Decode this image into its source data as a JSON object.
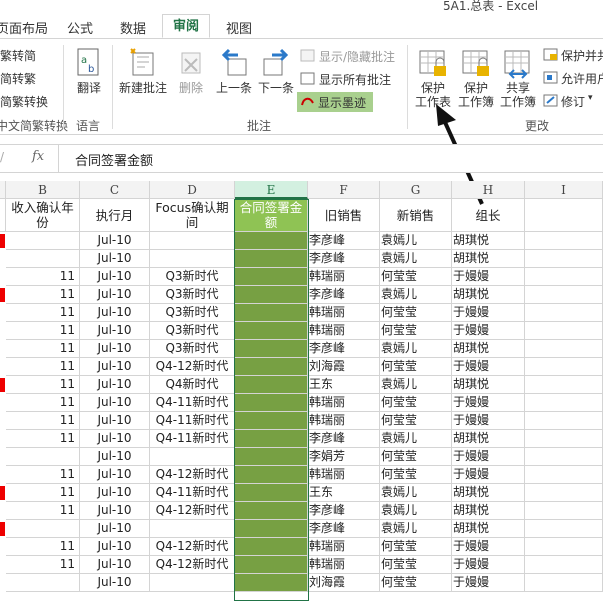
{
  "window": {
    "title": "5A1.总表 - Excel"
  },
  "tabs": [
    {
      "label": "页面布局",
      "active": false
    },
    {
      "label": "公式",
      "active": false
    },
    {
      "label": "数据",
      "active": false
    },
    {
      "label": "审阅",
      "active": true
    },
    {
      "label": "视图",
      "active": false
    }
  ],
  "ribbon": {
    "chinese_group": {
      "items": [
        "繁转简",
        "简转繁",
        "简繁转换"
      ],
      "label": "中文简繁转换"
    },
    "language_group": {
      "translate": "翻译",
      "label": "语言"
    },
    "comments_group": {
      "new_comment": "新建批注",
      "delete": "删除",
      "previous": "上一条",
      "next": "下一条",
      "show_hide": "显示/隐藏批注",
      "show_all": "显示所有批注",
      "show_ink": "显示墨迹",
      "label": "批注"
    },
    "changes_group": {
      "protect_sheet_1": "保护",
      "protect_sheet_2": "工作表",
      "protect_book_1": "保护",
      "protect_book_2": "工作簿",
      "share_1": "共享",
      "share_2": "工作簿",
      "protect_share": "保护并共",
      "allow_users": "允许用户",
      "track_changes": "修订",
      "label": "更改"
    }
  },
  "formula_bar": {
    "fx": "fx",
    "content": "合同签署金额"
  },
  "accent_color": "#217346",
  "highlight_color": "#77a043",
  "columns": [
    "B",
    "C",
    "D",
    "E",
    "F",
    "G",
    "H",
    "I"
  ],
  "headers": {
    "B": "收入确认年份",
    "C": "执行月",
    "D": "Focus确认期间",
    "E": "合同签署金额",
    "F": "旧销售",
    "G": "新销售",
    "H": "组长"
  },
  "rows": [
    {
      "b": "",
      "c": "Jul-10",
      "d": "",
      "f": "李彦峰",
      "g": "袁嫣儿",
      "h": "胡琪悦",
      "red": true
    },
    {
      "b": "",
      "c": "Jul-10",
      "d": "",
      "f": "李彦峰",
      "g": "袁嫣儿",
      "h": "胡琪悦",
      "red": false
    },
    {
      "b": "11",
      "c": "Jul-10",
      "d": "Q3新时代",
      "f": "韩瑞丽",
      "g": "何莹莹",
      "h": "于嫚嫚",
      "red": false
    },
    {
      "b": "11",
      "c": "Jul-10",
      "d": "Q3新时代",
      "f": "李彦峰",
      "g": "袁嫣儿",
      "h": "胡琪悦",
      "red": true
    },
    {
      "b": "11",
      "c": "Jul-10",
      "d": "Q3新时代",
      "f": "韩瑞丽",
      "g": "何莹莹",
      "h": "于嫚嫚",
      "red": false
    },
    {
      "b": "11",
      "c": "Jul-10",
      "d": "Q3新时代",
      "f": "韩瑞丽",
      "g": "何莹莹",
      "h": "于嫚嫚",
      "red": false
    },
    {
      "b": "11",
      "c": "Jul-10",
      "d": "Q3新时代",
      "f": "李彦峰",
      "g": "袁嫣儿",
      "h": "胡琪悦",
      "red": false
    },
    {
      "b": "11",
      "c": "Jul-10",
      "d": "Q4-12新时代",
      "f": "刘海霞",
      "g": "何莹莹",
      "h": "于嫚嫚",
      "red": false
    },
    {
      "b": "11",
      "c": "Jul-10",
      "d": "Q4新时代",
      "f": "王东",
      "g": "袁嫣儿",
      "h": "胡琪悦",
      "red": true
    },
    {
      "b": "11",
      "c": "Jul-10",
      "d": "Q4-11新时代",
      "f": "韩瑞丽",
      "g": "何莹莹",
      "h": "于嫚嫚",
      "red": false
    },
    {
      "b": "11",
      "c": "Jul-10",
      "d": "Q4-11新时代",
      "f": "韩瑞丽",
      "g": "何莹莹",
      "h": "于嫚嫚",
      "red": false
    },
    {
      "b": "11",
      "c": "Jul-10",
      "d": "Q4-11新时代",
      "f": "李彦峰",
      "g": "袁嫣儿",
      "h": "胡琪悦",
      "red": false
    },
    {
      "b": "",
      "c": "Jul-10",
      "d": "",
      "f": "李娟芳",
      "g": "何莹莹",
      "h": "于嫚嫚",
      "red": false
    },
    {
      "b": "11",
      "c": "Jul-10",
      "d": "Q4-12新时代",
      "f": "韩瑞丽",
      "g": "何莹莹",
      "h": "于嫚嫚",
      "red": false
    },
    {
      "b": "11",
      "c": "Jul-10",
      "d": "Q4-11新时代",
      "f": "王东",
      "g": "袁嫣儿",
      "h": "胡琪悦",
      "red": true
    },
    {
      "b": "11",
      "c": "Jul-10",
      "d": "Q4-12新时代",
      "f": "李彦峰",
      "g": "袁嫣儿",
      "h": "胡琪悦",
      "red": false
    },
    {
      "b": "",
      "c": "Jul-10",
      "d": "",
      "f": "李彦峰",
      "g": "袁嫣儿",
      "h": "胡琪悦",
      "red": true
    },
    {
      "b": "11",
      "c": "Jul-10",
      "d": "Q4-12新时代",
      "f": "韩瑞丽",
      "g": "何莹莹",
      "h": "于嫚嫚",
      "red": false
    },
    {
      "b": "11",
      "c": "Jul-10",
      "d": "Q4-12新时代",
      "f": "韩瑞丽",
      "g": "何莹莹",
      "h": "于嫚嫚",
      "red": false
    },
    {
      "b": "",
      "c": "Jul-10",
      "d": "",
      "f": "刘海霞",
      "g": "何莹莹",
      "h": "于嫚嫚",
      "red": false
    }
  ]
}
